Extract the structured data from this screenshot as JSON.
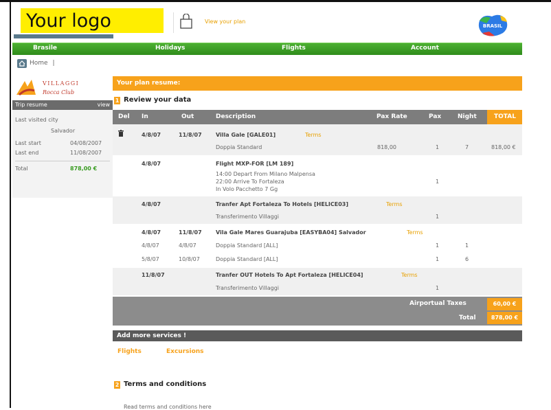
{
  "header": {
    "logo_text": "Your logo",
    "plan_link": "View your plan",
    "brand_badge": "BRASIL"
  },
  "nav": {
    "items": [
      "Brasile",
      "Holidays",
      "Flights",
      "Account"
    ]
  },
  "breadcrumb": {
    "home": "Home",
    "separator": "|"
  },
  "club_logo": {
    "line1": "VILLAGGI",
    "line2": "Rocca Club"
  },
  "sidebar": {
    "title": "Trip resume",
    "view": "view",
    "last_city_label": "Last visited city",
    "last_city": "Salvador",
    "last_start_label": "Last start",
    "last_start": "04/08/2007",
    "last_end_label": "Last end",
    "last_end": "11/08/2007",
    "total_label": "Total",
    "total": "878,00 €"
  },
  "plan_resume": "Your plan resume:",
  "review": {
    "number": "1",
    "title": "Review your data"
  },
  "table": {
    "headers": {
      "del": "Del",
      "in": "In",
      "out": "Out",
      "description": "Description",
      "pax_rate": "Pax Rate",
      "pax": "Pax",
      "night": "Night",
      "total": "TOTAL"
    },
    "terms_label": "Terms",
    "rows": [
      {
        "in": "4/8/07",
        "out": "11/8/07",
        "desc": "Villa Gale [GALE01]",
        "sub": "Doppia Standard",
        "pax_rate": "818,00",
        "pax": "1",
        "night": "7",
        "total": "818,00 €"
      },
      {
        "in": "4/8/07",
        "desc": "Flight MXP-FOR [LM 189]",
        "sub1": "14:00 Depart From Milano Malpensa",
        "sub2": "22:00 Arrive To Fortaleza",
        "sub3": "In Volo Pacchetto 7 Gg",
        "pax": "1"
      },
      {
        "in": "4/8/07",
        "desc": "Tranfer Apt Fortaleza To Hotels [HELICE03]",
        "sub": "Transferimento Villaggi",
        "pax": "1"
      },
      {
        "in": "4/8/07",
        "out": "11/8/07",
        "desc": "Vila Gale Mares Guarajuba [EASYBA04] Salvador",
        "l1_in": "4/8/07",
        "l1_out": "4/8/07",
        "l1_desc": "Doppia Standard [ALL]",
        "l1_pax": "1",
        "l1_night": "1",
        "l2_in": "5/8/07",
        "l2_out": "10/8/07",
        "l2_desc": "Doppia Standard [ALL]",
        "l2_pax": "1",
        "l2_night": "6"
      },
      {
        "in": "11/8/07",
        "desc": "Tranfer OUT Hotels To Apt Fortaleza [HELICE04]",
        "sub": "Transferimento Villaggi",
        "pax": "1"
      }
    ]
  },
  "summary": {
    "taxes_label": "Airportual Taxes",
    "taxes_value": "60,00 €",
    "total_label": "Total",
    "total_value": "878,00 €"
  },
  "more_services": {
    "title": "Add more services !",
    "links": [
      "Flights",
      "Excursions"
    ]
  },
  "terms_section": {
    "number": "2",
    "title": "Terms and conditions",
    "text": "Read terms and conditions here"
  },
  "colors": {
    "orange": "#f7a21b",
    "green": "#3a9c22",
    "grey": "#7d7d7d",
    "logo_yellow": "#ffee00"
  }
}
